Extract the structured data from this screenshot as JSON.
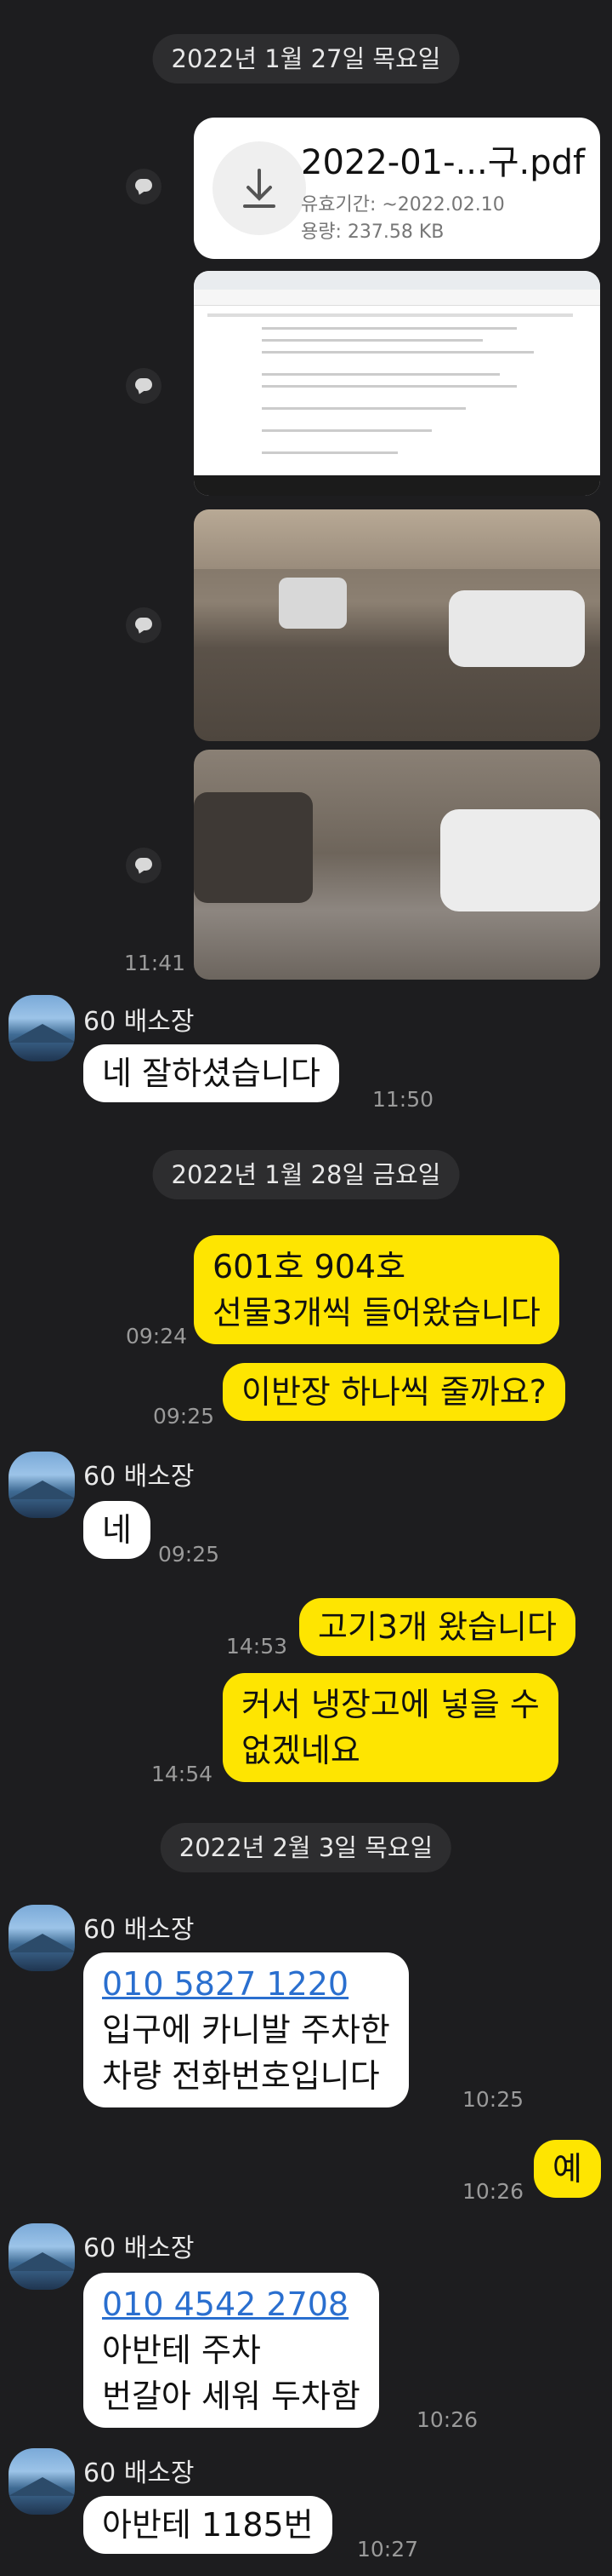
{
  "dates": [
    "2022년 1월 27일 목요일",
    "2022년 1월 28일 금요일",
    "2022년 2월 3일 목요일"
  ],
  "file": {
    "name": "2022-01-...구.pdf",
    "expiry": "유효기간: ~2022.02.10",
    "size": "용량: 237.58 KB"
  },
  "sender_name": "60 배소장",
  "messages": {
    "t1141": "11:41",
    "m1": "네 잘하셨습니다",
    "t1150": "11:50",
    "o1_line1": "601호 904호",
    "o1_line2": "선물3개씩 들어왔습니다",
    "t0924": "09:24",
    "o2": "이반장 하나씩 줄까요?",
    "t0925a": "09:25",
    "m2": "네",
    "t0925b": "09:25",
    "o3": "고기3개 왔습니다",
    "t1453": "14:53",
    "o4_line1": "커서 냉장고에 넣을 수",
    "o4_line2": "없겠네요",
    "t1454": "14:54",
    "m3_phone": "010 5827 1220",
    "m3_line2": "입구에 카니발 주차한",
    "m3_line3": "차량 전화번호입니다",
    "t1025": "10:25",
    "o5": "예",
    "t1026a": "10:26",
    "m4_phone": "010 4542 2708",
    "m4_line2": "아반테 주차",
    "m4_line3": "번갈아 세워 두차함",
    "t1026b": "10:26",
    "m5": "아반테 1185번",
    "t1027": "10:27"
  },
  "colors": {
    "background": "#1d1d1f",
    "incoming": "#ffffff",
    "outgoing": "#fee501",
    "link": "#2a6fcf"
  },
  "icons": [
    "share-icon",
    "download-icon",
    "avatar-lake-photo"
  ]
}
